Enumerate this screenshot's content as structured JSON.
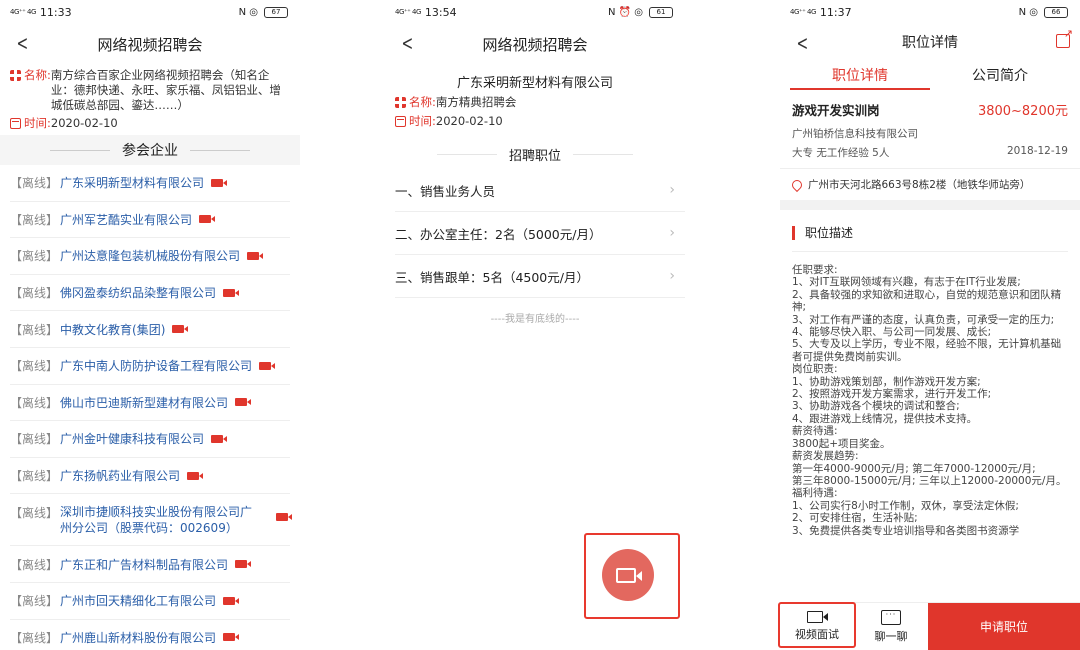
{
  "screen1": {
    "status": {
      "time": "11:33",
      "signal": "4G⁺⁺ 4G",
      "icons": "N ◎",
      "battery": "67"
    },
    "title": "网络视频招聘会",
    "name_label": "名称:",
    "name_value": "南方综合百家企业网络视频招聘会（知名企业：德邦快递、永旺、家乐福、凤铝铝业、增城低碳总部园、鎏达……）",
    "time_label": "时间:",
    "time_value": "2020-02-10",
    "section_title": "参会企业",
    "companies": [
      {
        "tag": "【离线】",
        "name": "广东采明新型材料有限公司"
      },
      {
        "tag": "【离线】",
        "name": "广州军艺酷实业有限公司"
      },
      {
        "tag": "【离线】",
        "name": "广州达意隆包装机械股份有限公司"
      },
      {
        "tag": "【离线】",
        "name": "佛冈盈泰纺织品染整有限公司"
      },
      {
        "tag": "【离线】",
        "name": "中教文化教育(集团)"
      },
      {
        "tag": "【离线】",
        "name": "广东中南人防防护设备工程有限公司"
      },
      {
        "tag": "【离线】",
        "name": "佛山市巴迪斯新型建材有限公司"
      },
      {
        "tag": "【离线】",
        "name": "广州金叶健康科技有限公司"
      },
      {
        "tag": "【离线】",
        "name": "广东扬帆药业有限公司"
      },
      {
        "tag": "【离线】",
        "name": "深圳市捷顺科技实业股份有限公司广州分公司（股票代码：002609）"
      },
      {
        "tag": "【离线】",
        "name": "广东正和广告材料制品有限公司"
      },
      {
        "tag": "【离线】",
        "name": "广州市回天精细化工有限公司"
      },
      {
        "tag": "【离线】",
        "name": "广州鹿山新材料股份有限公司"
      }
    ]
  },
  "screen2": {
    "status": {
      "time": "13:54",
      "signal": "4G⁺⁺ 4G",
      "icons": "N ⏰ ◎",
      "battery": "61"
    },
    "title": "网络视频招聘会",
    "company": "广东采明新型材料有限公司",
    "name_label": "名称:",
    "name_value": "南方精典招聘会",
    "time_label": "时间:",
    "time_value": "2020-02-10",
    "section_title": "招聘职位",
    "jobs": [
      "一、销售业务人员",
      "二、办公室主任：2名（5000元/月）",
      "三、销售跟单：5名（4500元/月）"
    ],
    "end_text": "----我是有底线的----"
  },
  "screen3": {
    "status": {
      "time": "11:37",
      "signal": "4G⁺⁺ 4G",
      "icons": "N ◎",
      "battery": "66"
    },
    "title": "职位详情",
    "tabs": [
      "职位详情",
      "公司简介"
    ],
    "job_title": "游戏开发实训岗",
    "salary": "3800~8200元",
    "company": "广州铂桥信息科技有限公司",
    "requirements": "大专  无工作经验  5人",
    "date": "2018-12-19",
    "address": "广州市天河北路663号8栋2楼（地铁华师站旁）",
    "desc_title": "职位描述",
    "description": "任职要求:\n1、对IT互联网领域有兴趣，有志于在IT行业发展;\n2、具备较强的求知欲和进取心，自觉的规范意识和团队精神;\n3、对工作有严谨的态度，认真负责，可承受一定的压力;\n4、能够尽快入职、与公司一同发展、成长;\n5、大专及以上学历，专业不限，经验不限，无计算机基础者可提供免费岗前实训。\n岗位职责:\n1、协助游戏策划部，制作游戏开发方案;\n2、按照游戏开发方案需求，进行开发工作;\n3、协助游戏各个模块的调试和整合;\n4、跟进游戏上线情况，提供技术支持。\n薪资待遇:\n3800起+项目奖金。\n薪资发展趋势:\n第一年4000-9000元/月; 第二年7000-12000元/月;\n第三年8000-15000元/月; 三年以上12000-20000元/月。\n福利待遇:\n1、公司实行8小时工作制，双休，享受法定休假;\n2、可安排住宿，生活补贴;\n3、免费提供各类专业培训指导和各类图书资源学",
    "bottom": {
      "video": "视频面试",
      "chat": "聊一聊",
      "apply": "申请职位"
    }
  }
}
